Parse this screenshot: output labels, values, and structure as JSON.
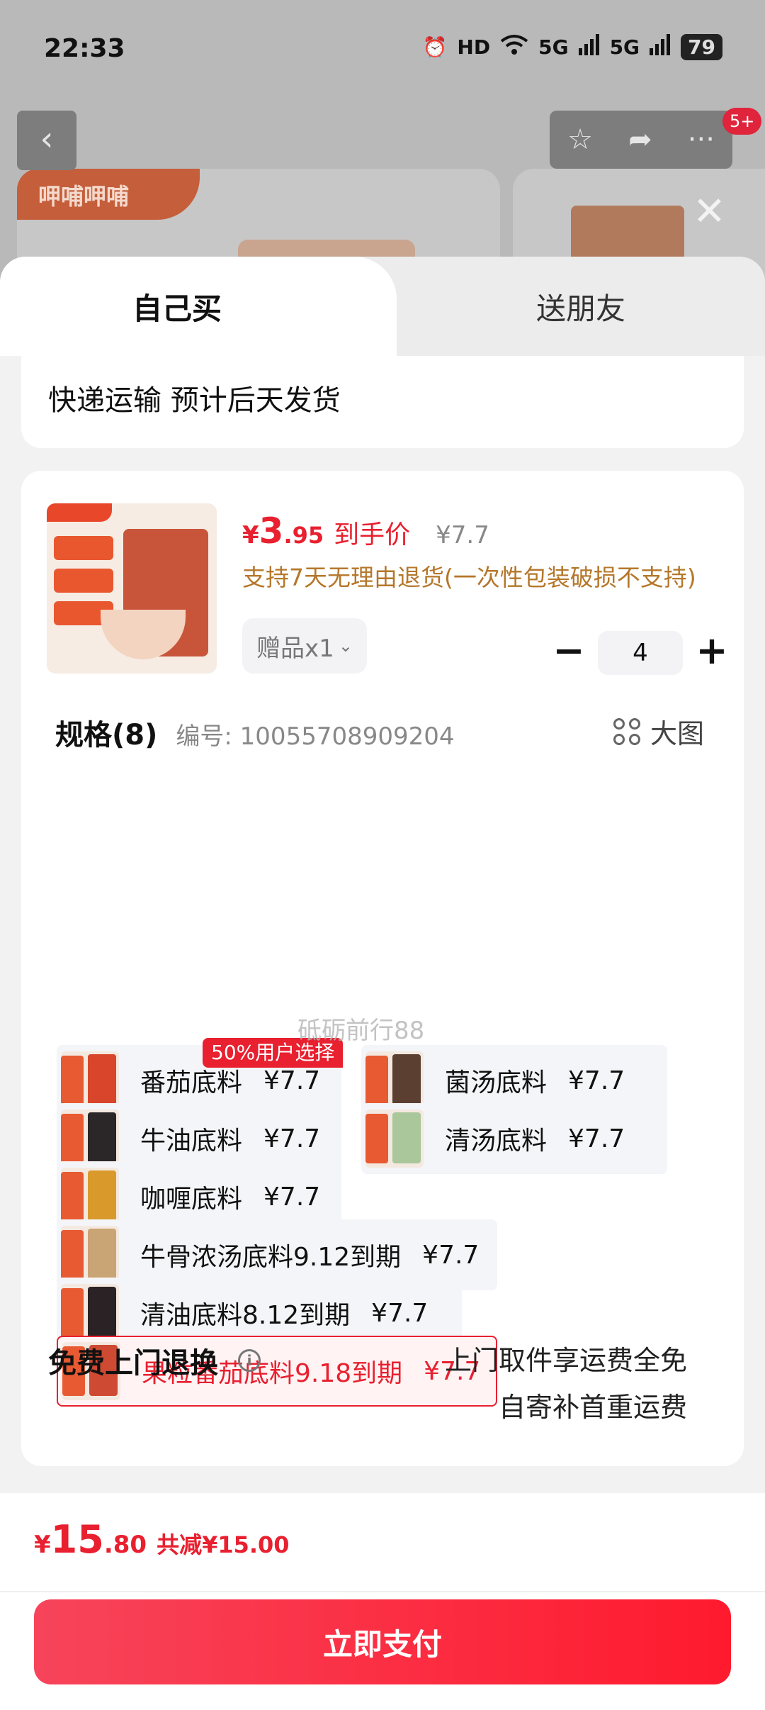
{
  "status_bar": {
    "time": "22:33",
    "hd": "HD",
    "net1": "5G",
    "net2": "5G",
    "battery": "79"
  },
  "background": {
    "badge": "5+",
    "store_logo": "呷哺呷哺"
  },
  "tabs": {
    "self": "自己买",
    "friend": "送朋友"
  },
  "shipping": {
    "text": "快递运输 预计后天发货"
  },
  "product": {
    "price_currency": "¥",
    "price_int": "3",
    "price_dec": ".95",
    "price_label": "到手价",
    "original_price": "¥7.7",
    "return_note": "支持7天无理由退货(一次性包装破损不支持)",
    "gift": "赠品x1",
    "quantity": "4",
    "minus": "−",
    "plus": "+"
  },
  "spec": {
    "title": "规格(8)",
    "code": "编号: 10055708909204",
    "big_picture": "大图",
    "hot_tag": "50%用户选择",
    "watermark": "砥砺前行88",
    "options": [
      {
        "name": "番茄底料",
        "price": "¥7.7",
        "thumb_color": "#d8452b"
      },
      {
        "name": "菌汤底料",
        "price": "¥7.7",
        "thumb_color": "#5b4032"
      },
      {
        "name": "牛油底料",
        "price": "¥7.7",
        "thumb_color": "#2b2628"
      },
      {
        "name": "清汤底料",
        "price": "¥7.7",
        "thumb_color": "#a9c79b"
      },
      {
        "name": "咖喱底料",
        "price": "¥7.7",
        "thumb_color": "#d99a2b"
      },
      {
        "name": "牛骨浓汤底料9.12到期",
        "price": "¥7.7",
        "thumb_color": "#c9a474"
      },
      {
        "name": "清油底料8.12到期",
        "price": "¥7.7",
        "thumb_color": "#2a2224"
      },
      {
        "name": "果粒番茄底料9.18到期",
        "price": "¥7.7",
        "thumb_color": "#cf4a32"
      }
    ]
  },
  "free_return": {
    "title": "免费上门退换",
    "line1": "上门取件享运费全免",
    "line2": "自寄补首重运费"
  },
  "footer": {
    "currency": "¥",
    "total_int": "15",
    "total_dec": ".80",
    "savings": "共减¥15.00",
    "pay_label": "立即支付"
  }
}
